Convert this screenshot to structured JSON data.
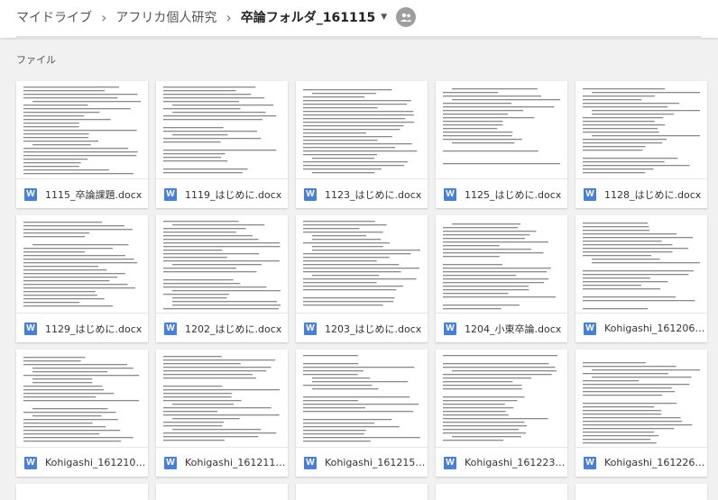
{
  "breadcrumb": {
    "root": "マイドライブ",
    "parent": "アフリカ個人研究",
    "current": "卒論フォルダ_161115"
  },
  "section_label": "ファイル",
  "file_type_icon_letter": "W",
  "colors": {
    "word_blue": "#4a7fd8",
    "shared_icon": "#9e9e9e"
  },
  "files": [
    {
      "name": "1115_卒論課題.docx"
    },
    {
      "name": "1119_はじめに.docx"
    },
    {
      "name": "1123_はじめに.docx"
    },
    {
      "name": "1125_はじめに.docx"
    },
    {
      "name": "1128_はじめに.docx"
    },
    {
      "name": "1129_はじめに.docx"
    },
    {
      "name": "1202_はじめに.docx"
    },
    {
      "name": "1203_はじめに.docx"
    },
    {
      "name": "1204_小東卒論.docx"
    },
    {
      "name": "Kohigashi_161206.d..."
    },
    {
      "name": "Kohigashi_161210.d..."
    },
    {
      "name": "Kohigashi_161211_3..."
    },
    {
      "name": "Kohigashi_161215.d..."
    },
    {
      "name": "Kohigashi_161223.d..."
    },
    {
      "name": "Kohigashi_161226_2..."
    }
  ]
}
